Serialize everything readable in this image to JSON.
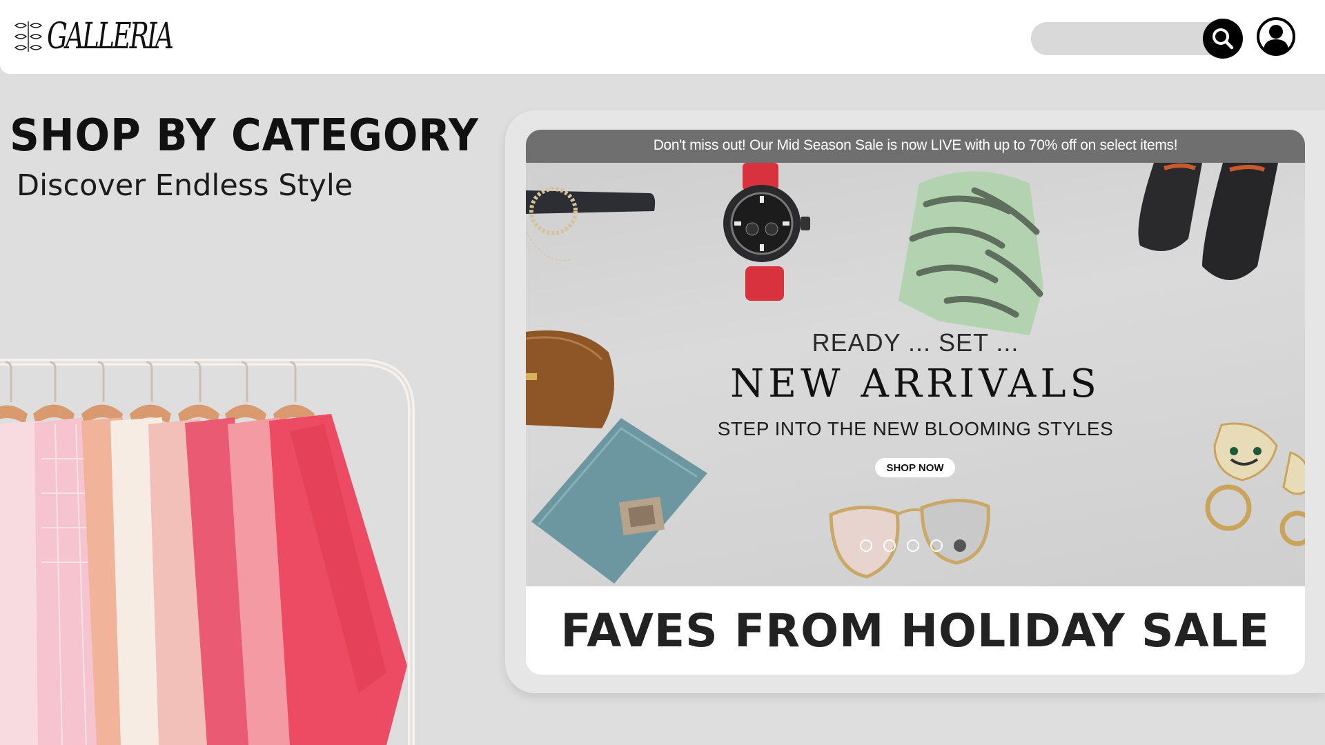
{
  "header": {
    "logo_text": "GALLERIA",
    "search": {
      "value": "",
      "placeholder": ""
    }
  },
  "category": {
    "title": "SHOP BY CATEGORY",
    "subtitle": "Discover Endless Style"
  },
  "banner": {
    "promo": "Don't miss out! Our Mid Season Sale is now LIVE with up to 70% off on select items!",
    "ready": "READY ...  SET ...",
    "headline": "NEW  ARRIVALS",
    "tagline": "STEP INTO THE NEW BLOOMING STYLES",
    "cta": "SHOP NOW",
    "carousel": {
      "slides": 5,
      "active_index": 4
    },
    "products": [
      "belt",
      "watch",
      "zebra-sweater",
      "loafers",
      "pouch",
      "wallet",
      "sunglasses",
      "panther-earrings"
    ],
    "watch_brand": "",
    "wallet_brand": ""
  },
  "faves": {
    "title": "FAVES FROM HOLIDAY SALE"
  },
  "colors": {
    "page_bg": "#dedede",
    "header_bg": "#ffffff",
    "promo_bar": "#6f6f6f",
    "search_pill": "#d9d9d9",
    "search_button": "#000000",
    "shirt_pinks": [
      "#f7dbe0",
      "#f4aec0",
      "#ee6f86",
      "#e34a60",
      "#f5c7cd"
    ]
  }
}
